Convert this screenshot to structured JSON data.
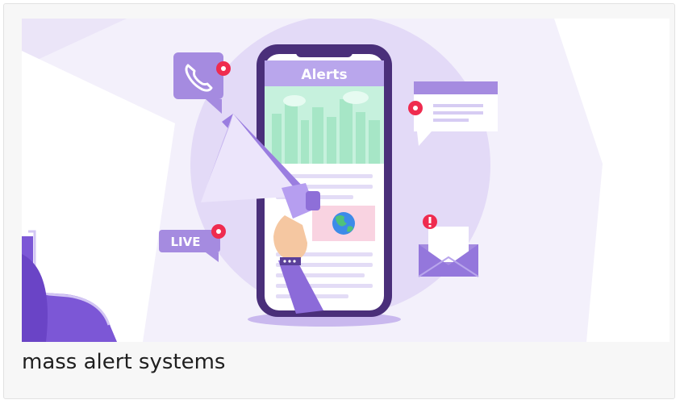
{
  "illustration": {
    "screen_title": "Alerts",
    "live_badge": "LIVE",
    "colors": {
      "phone_frame": "#4a2f7a",
      "bubble_purple": "#a58be0",
      "badge_red": "#ef2b4f",
      "background_circle": "#e3daf7",
      "screen_green": "#c6f1dd"
    }
  },
  "caption": {
    "text": "mass alert systems"
  }
}
